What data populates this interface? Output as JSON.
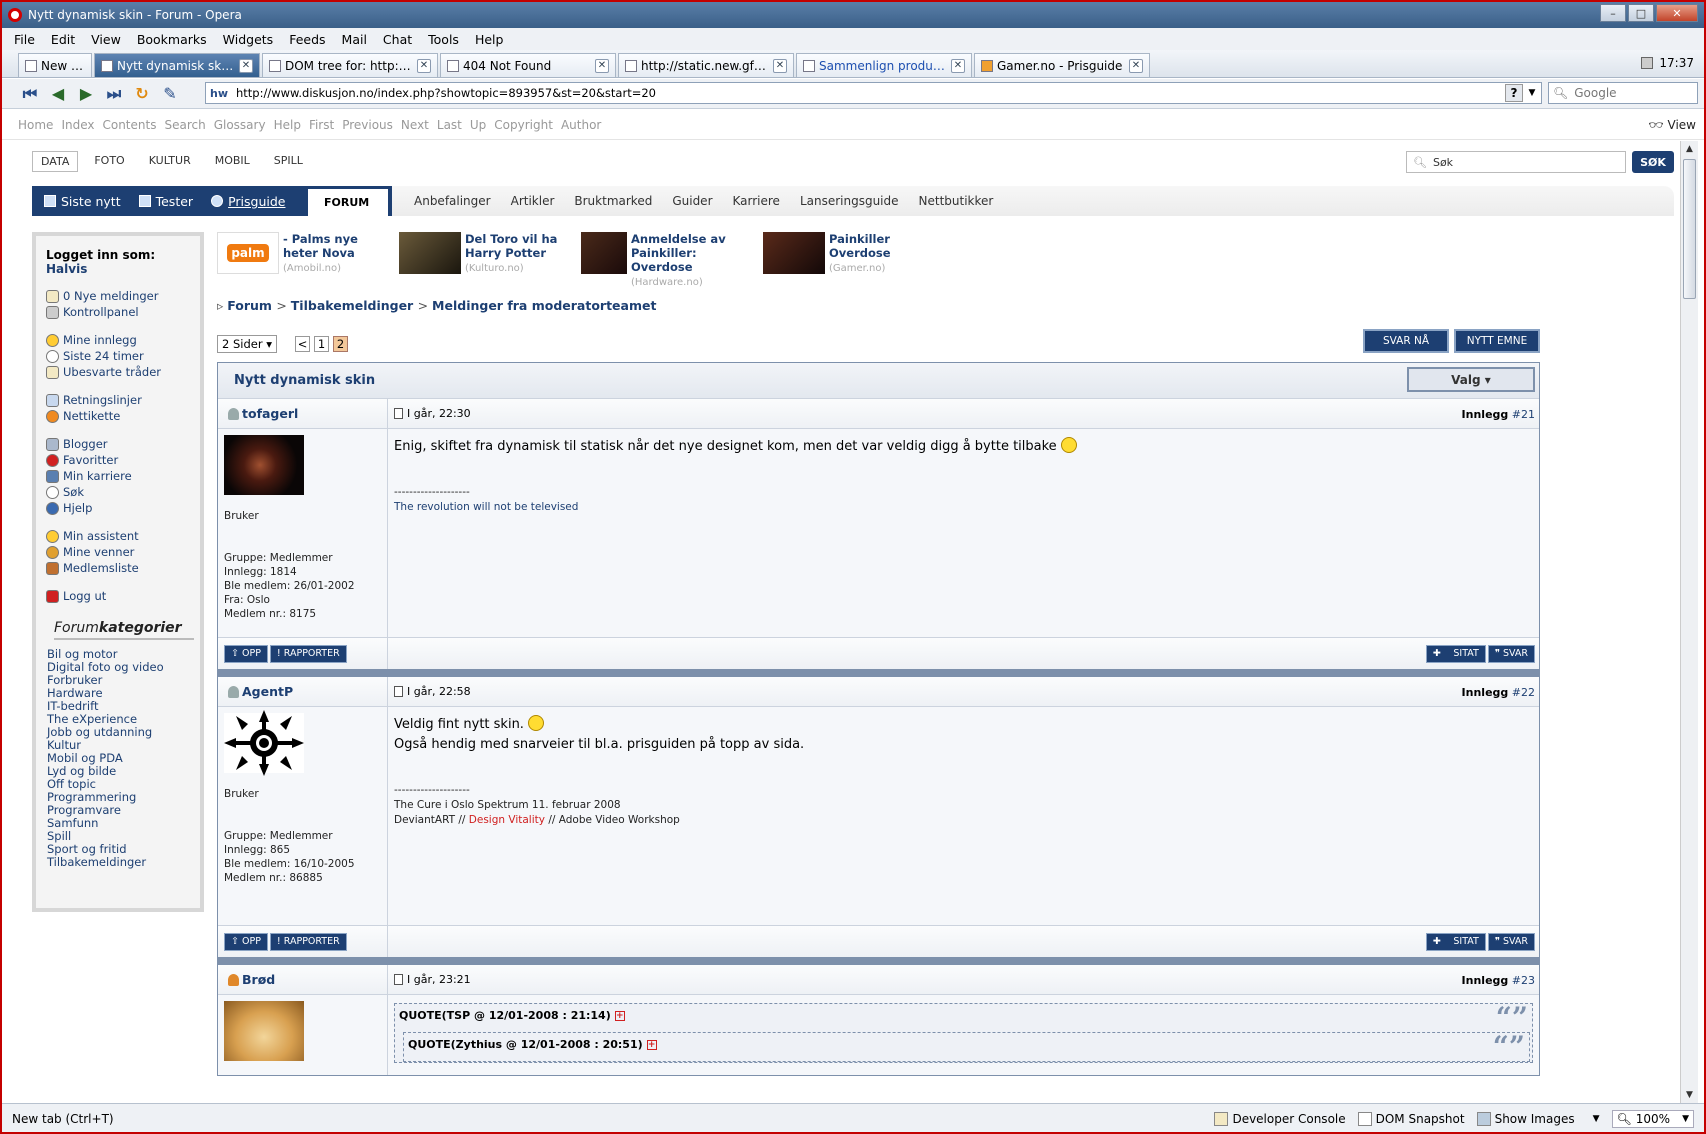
{
  "window": {
    "title": "Nytt dynamisk skin - Forum - Opera"
  },
  "menu": [
    "File",
    "Edit",
    "View",
    "Bookmarks",
    "Widgets",
    "Feeds",
    "Mail",
    "Chat",
    "Tools",
    "Help"
  ],
  "tabs": {
    "new_tab": "New tab",
    "items": [
      {
        "label": "Nytt dynamisk skin - F..."
      },
      {
        "label": "DOM tree for: http://w..."
      },
      {
        "label": "404 Not Found"
      },
      {
        "label": "http://static.new.gfx.n..."
      },
      {
        "label": "Sammenlign produkter..."
      },
      {
        "label": "Gamer.no - Prisguide"
      }
    ],
    "clock": "17:37"
  },
  "address": {
    "url": "http://www.diskusjon.no/index.php?showtopic=893957&st=20&start=20",
    "site_icon": "hw",
    "help": "?"
  },
  "search": {
    "placeholder": "Google"
  },
  "navbar": {
    "items": [
      "Home",
      "Index",
      "Contents",
      "Search",
      "Glossary",
      "Help",
      "First",
      "Previous",
      "Next",
      "Last",
      "Up",
      "Copyright",
      "Author"
    ],
    "view": "View"
  },
  "site": {
    "topcats": [
      "DATA",
      "FOTO",
      "KULTUR",
      "MOBIL",
      "SPILL"
    ],
    "search_value": "Søk",
    "search_button": "SØK",
    "mainnav": [
      "Siste nytt",
      "Tester",
      "Prisguide"
    ],
    "forum_tab": "FORUM",
    "subnav": [
      "Anbefalinger",
      "Artikler",
      "Bruktmarked",
      "Guider",
      "Karriere",
      "Lanseringsguide",
      "Nettbutikker"
    ]
  },
  "sidebar": {
    "login_label": "Logget inn som:",
    "login_user": "Halvis",
    "groups": [
      [
        "0 Nye meldinger",
        "Kontrollpanel"
      ],
      [
        "Mine innlegg",
        "Siste 24 timer",
        "Ubesvarte tråder"
      ],
      [
        "Retningslinjer",
        "Nettikette"
      ],
      [
        "Blogger",
        "Favoritter",
        "Min karriere",
        "Søk",
        "Hjelp"
      ],
      [
        "Min assistent",
        "Mine venner",
        "Medlemsliste"
      ],
      [
        "Logg ut"
      ]
    ],
    "cat_title_a": "Forum",
    "cat_title_b": "kategorier",
    "categories": [
      "Bil og motor",
      "Digital foto og video",
      "Forbruker",
      "Hardware",
      "IT-bedrift",
      "The eXperience",
      "Jobb og utdanning",
      "Kultur",
      "Mobil og PDA",
      "Lyd og bilde",
      "Off topic",
      "Programmering",
      "Programvare",
      "Samfunn",
      "Spill",
      "Sport og fritid",
      "Tilbakemeldinger"
    ]
  },
  "teasers": [
    {
      "title": "- Palms nye heter Nova",
      "source": "(Amobil.no)"
    },
    {
      "title": "Del Toro vil ha Harry Potter",
      "source": "(Kulturo.no)"
    },
    {
      "title": "Anmeldelse av Painkiller: Overdose",
      "source": "(Hardware.no)"
    },
    {
      "title": "Painkiller Overdose",
      "source": "(Gamer.no)"
    }
  ],
  "breadcrumb": [
    "Forum",
    "Tilbakemeldinger",
    "Meldinger fra moderatorteamet"
  ],
  "pagination": {
    "select": "2 Sider",
    "prev": "<",
    "pages": [
      "1",
      "2"
    ],
    "current": "2"
  },
  "buttons": {
    "reply_now": "SVAR NÅ",
    "new_topic": "NYTT EMNE",
    "up": "OPP",
    "report": "RAPPORTER",
    "quote": "SITAT",
    "reply": "SVAR"
  },
  "thread": {
    "title": "Nytt dynamisk skin",
    "valg": "Valg"
  },
  "posts": [
    {
      "author": "tofagerl",
      "date": "I går, 22:30",
      "label": "Innlegg",
      "num": "#21",
      "rank": "Bruker",
      "group": "Gruppe: Medlemmer",
      "posts": "Innlegg: 1814",
      "joined": "Ble medlem: 26/01-2002",
      "from": "Fra: Oslo",
      "member_no": "Medlem nr.: 8175",
      "text": "Enig, skiftet fra dynamisk til statisk når det nye designet kom, men det var veldig digg å bytte tilbake",
      "sig_sep": "--------------------",
      "sig": "The revolution will not be televised"
    },
    {
      "author": "AgentP",
      "date": "I går, 22:58",
      "label": "Innlegg",
      "num": "#22",
      "rank": "Bruker",
      "group": "Gruppe: Medlemmer",
      "posts": "Innlegg: 865",
      "joined": "Ble medlem: 16/10-2005",
      "member_no": "Medlem nr.: 86885",
      "text1": "Veldig fint nytt skin.",
      "text2": "Også hendig med snarveier til bl.a. prisguiden på topp av sida.",
      "sig_sep": "--------------------",
      "sig1": "The Cure i Oslo Spektrum 11. februar 2008",
      "sig2a": "DeviantART //",
      "sig2b": "Design Vitality",
      "sig2c": "// Adobe Video Workshop"
    },
    {
      "author": "Brød",
      "date": "I går, 23:21",
      "label": "Innlegg",
      "num": "#23",
      "quote1": "QUOTE(TSP @ 12/01-2008 : 21:14)",
      "quote2": "QUOTE(Zythius @ 12/01-2008 : 20:51)"
    }
  ],
  "status": {
    "left": "New tab (Ctrl+T)",
    "dev_console": "Developer Console",
    "dom_snapshot": "DOM Snapshot",
    "show_images": "Show Images",
    "zoom": "100%"
  },
  "colors": {
    "accent": "#1d3f72",
    "frame": "#c40000"
  }
}
